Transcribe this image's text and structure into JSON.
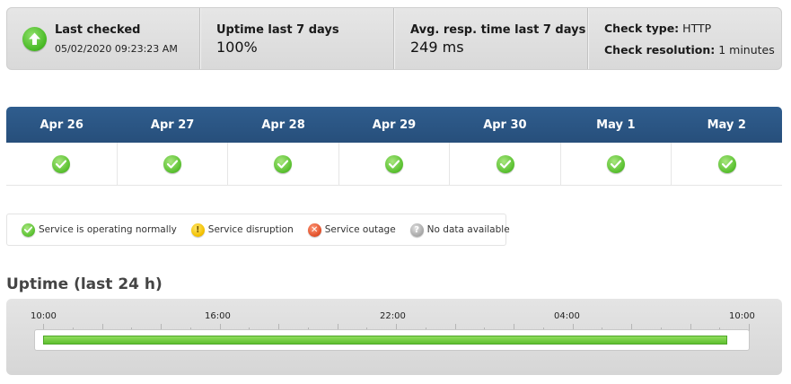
{
  "summary": {
    "last_checked_label": "Last checked",
    "last_checked_value": "05/02/2020 09:23:23 AM",
    "uptime_label": "Uptime last 7 days",
    "uptime_value": "100%",
    "resp_label": "Avg. resp. time last 7 days",
    "resp_value": "249 ms",
    "check_type_label": "Check type:",
    "check_type_value": "HTTP",
    "check_res_label": "Check resolution:",
    "check_res_value": "1 minutes",
    "status_icon": "up-arrow-icon",
    "status_color": "#46b823"
  },
  "calendar": {
    "days": [
      {
        "label": "Apr 26",
        "status": "ok"
      },
      {
        "label": "Apr 27",
        "status": "ok"
      },
      {
        "label": "Apr 28",
        "status": "ok"
      },
      {
        "label": "Apr 29",
        "status": "ok"
      },
      {
        "label": "Apr 30",
        "status": "ok"
      },
      {
        "label": "May 1",
        "status": "ok"
      },
      {
        "label": "May 2",
        "status": "ok"
      }
    ],
    "header_color": "#2f5d8e"
  },
  "legend": {
    "ok": "Service is operating normally",
    "disruption": "Service disruption",
    "outage": "Service outage",
    "no_data": "No data available"
  },
  "uptime24": {
    "title": "Uptime (last 24 h)",
    "tick_labels": [
      "10:00",
      "16:00",
      "22:00",
      "04:00",
      "10:00"
    ],
    "uptime_fraction": 0.97,
    "bar_color": "#5fc02f"
  }
}
